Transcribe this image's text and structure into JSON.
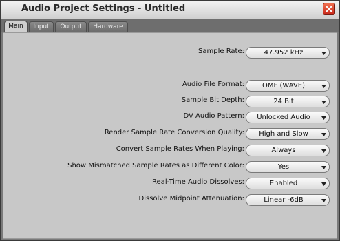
{
  "window": {
    "title": "Audio Project Settings - Untitled",
    "close_icon": "close-x-icon"
  },
  "tabs": [
    {
      "label": "Main",
      "active": true
    },
    {
      "label": "Input",
      "active": false
    },
    {
      "label": "Output",
      "active": false
    },
    {
      "label": "Hardware",
      "active": false
    }
  ],
  "settings": [
    {
      "label": "Sample Rate:",
      "value": "47.952 kHz"
    },
    {
      "label": "Audio File Format:",
      "value": "OMF (WAVE)"
    },
    {
      "label": "Sample Bit Depth:",
      "value": "24 Bit"
    },
    {
      "label": "DV Audio Pattern:",
      "value": "Unlocked Audio"
    },
    {
      "label": "Render Sample Rate Conversion Quality:",
      "value": "High and Slow"
    },
    {
      "label": "Convert Sample Rates When Playing:",
      "value": "Always"
    },
    {
      "label": "Show Mismatched Sample Rates as Different Color:",
      "value": "Yes"
    },
    {
      "label": "Real-Time Audio Dissolves:",
      "value": "Enabled"
    },
    {
      "label": "Dissolve Midpoint Attenuation:",
      "value": "Linear -6dB"
    }
  ],
  "colors": {
    "panel": "#c8c8c8",
    "frame": "#7a7a7a",
    "close_button": "#d8402a"
  }
}
